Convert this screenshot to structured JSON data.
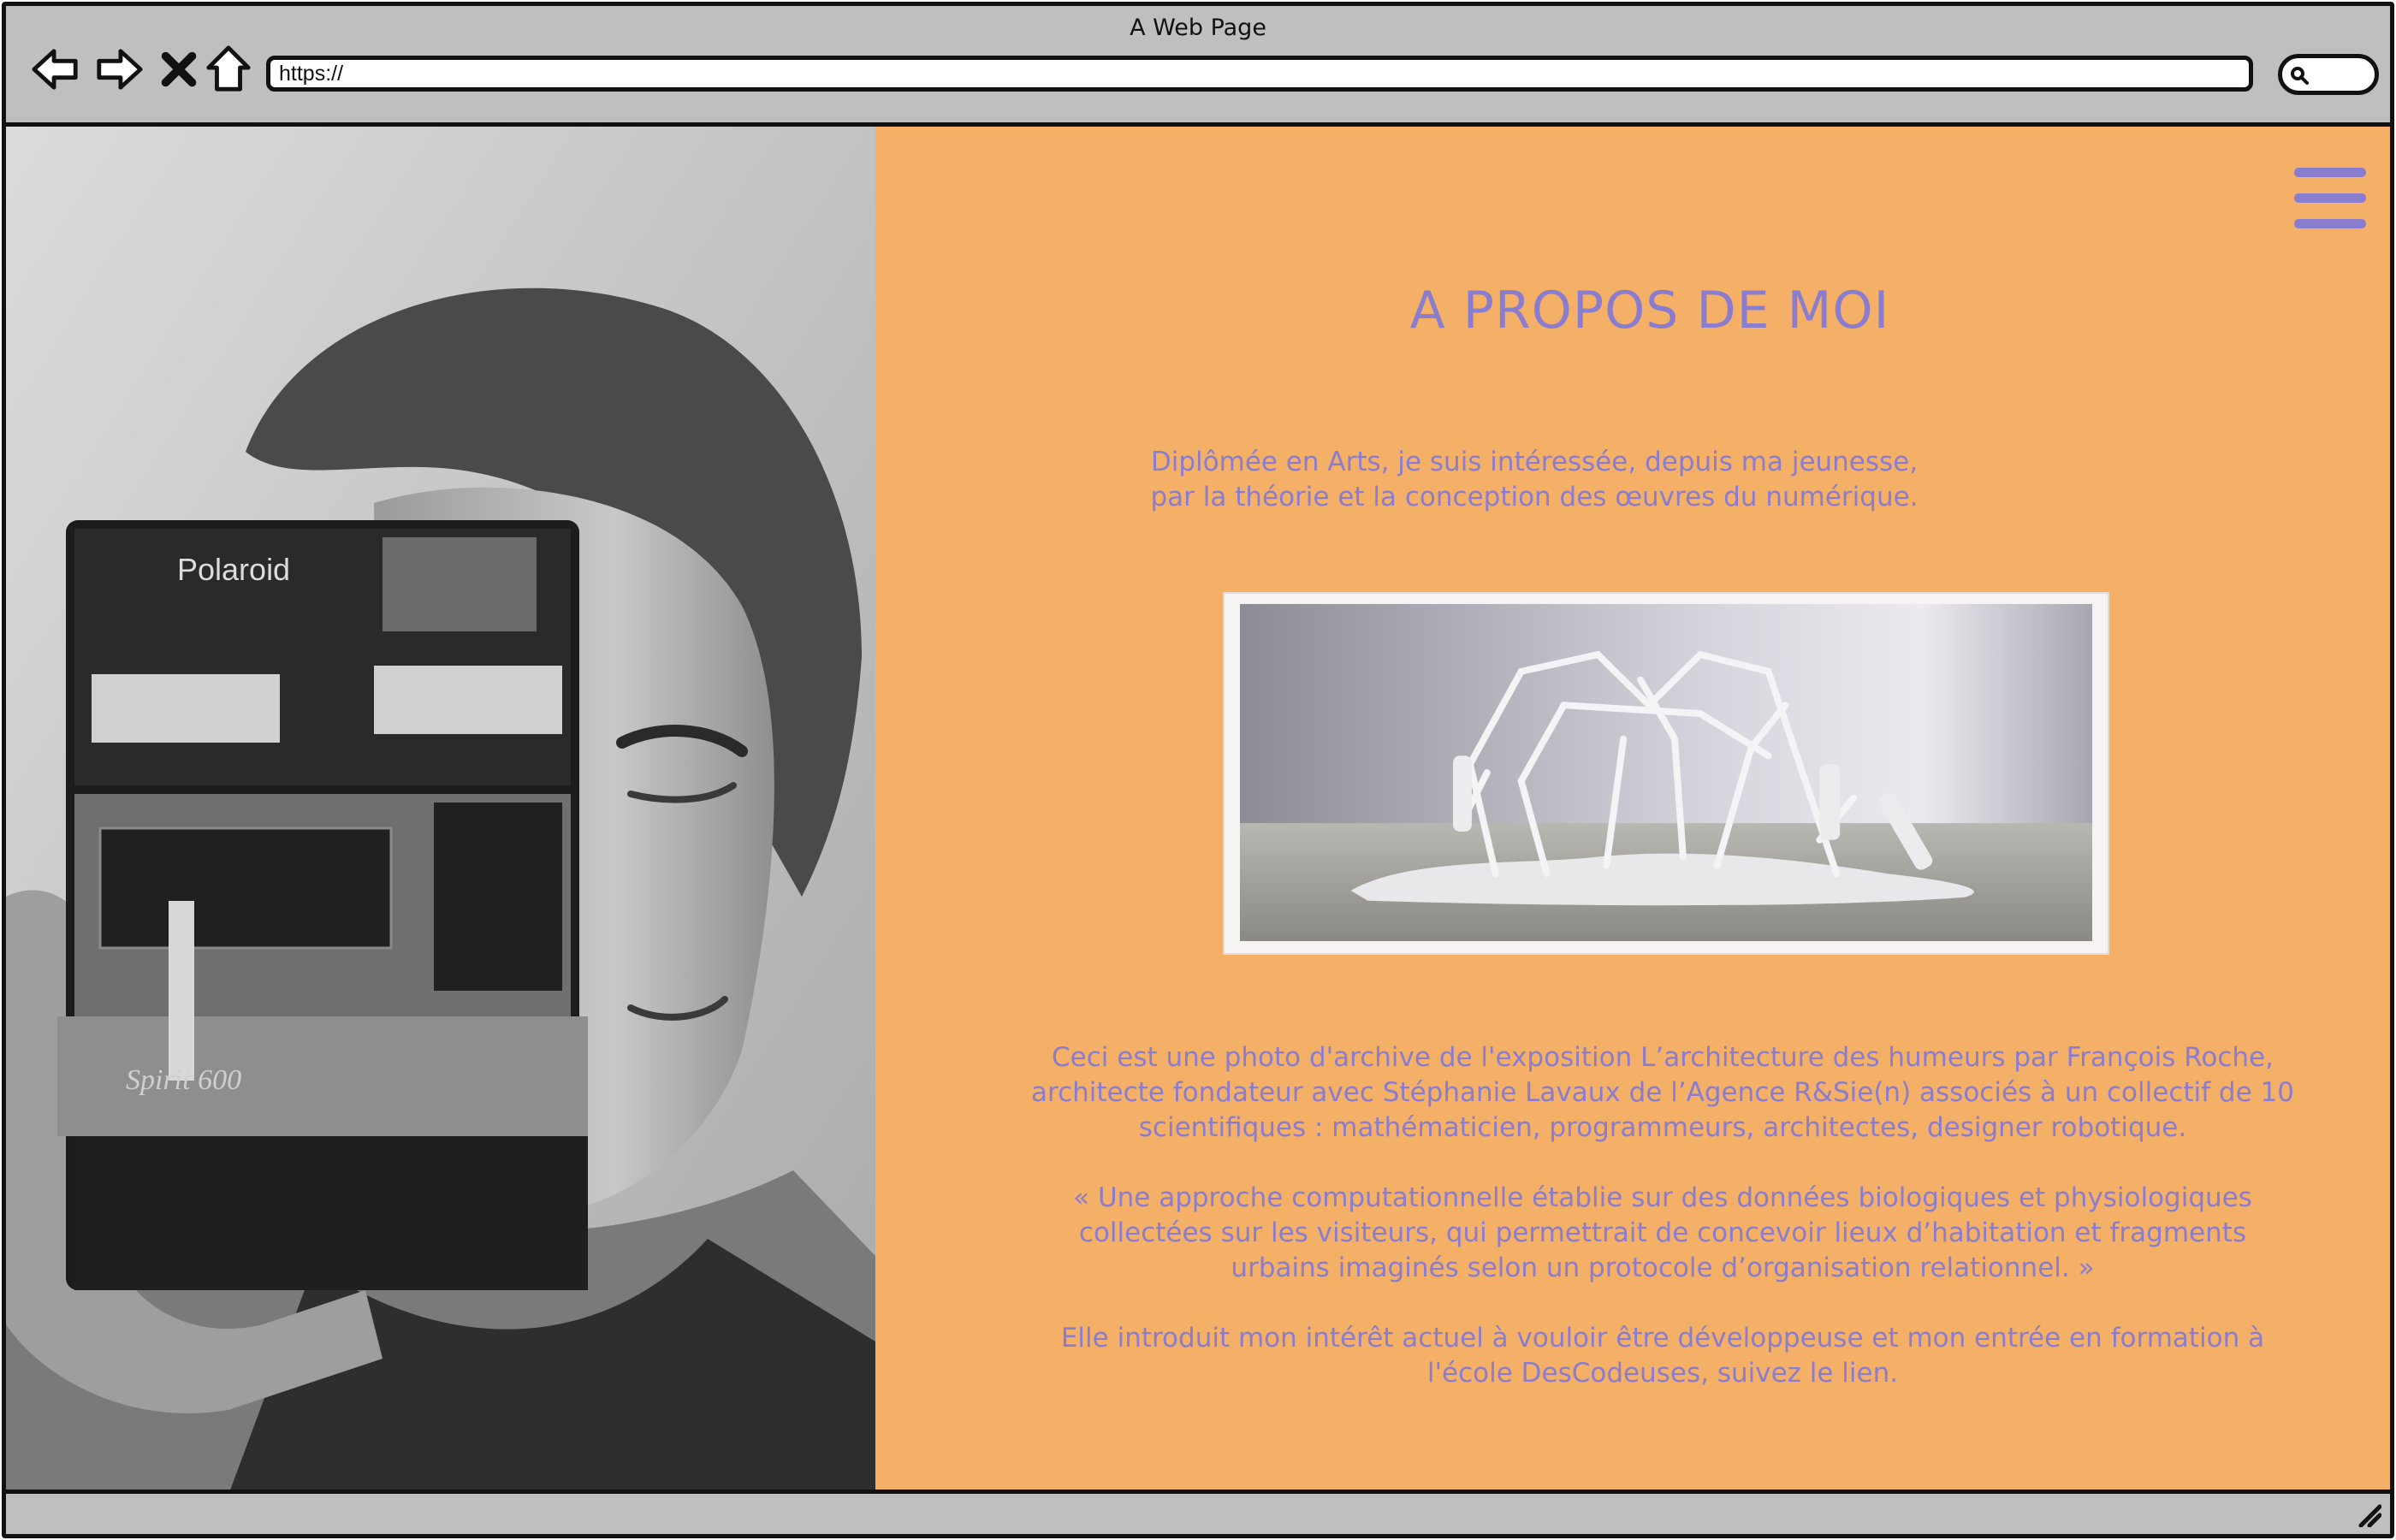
{
  "window": {
    "title": "A Web Page"
  },
  "toolbar": {
    "back_icon": "back-arrow-icon",
    "forward_icon": "forward-arrow-icon",
    "stop_icon": "close-icon",
    "home_icon": "home-icon",
    "url": "https://",
    "search_icon": "search-icon"
  },
  "left_photo": {
    "camera_brand": "Polaroid",
    "camera_model": "Spirit 600"
  },
  "about": {
    "menu_icon": "hamburger-menu-icon",
    "title": "A PROPOS  DE MOI",
    "intro_line_1": "Diplômée en Arts, je suis intéressée, depuis ma jeunesse,",
    "intro_line_2": "par la théorie et la conception des œuvres du numérique.",
    "paragraph_1": "Ceci est une photo d'archive de l'exposition L’architecture des humeurs par François Roche, architecte fondateur avec Stéphanie Lavaux de l’Agence R&Sie(n) associés à un collectif de 10 scientifiques : mathématicien, programmeurs, architectes, designer robotique.",
    "paragraph_2": "« Une approche computationnelle établie sur des données biologiques et physiologiques collectées sur les visiteurs, qui permettrait de concevoir lieux d’habitation et fragments urbains imaginés selon un protocole d’organisation relationnel. »",
    "paragraph_3": "Elle introduit mon intérêt actuel à vouloir être développeuse et mon entrée en formation à l'école DesCodeuses, suivez le lien."
  },
  "colors": {
    "accent": "#8a7ccf",
    "panel_background": "#f4b066",
    "chrome": "#bfbfbf"
  }
}
